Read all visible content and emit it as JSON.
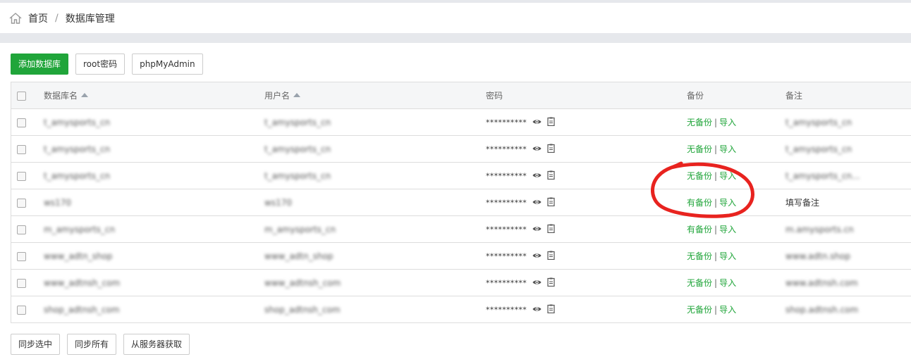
{
  "breadcrumb": {
    "home": "首页",
    "separator": "/",
    "current": "数据库管理"
  },
  "toolbar": {
    "add_db": "添加数据库",
    "root_pw": "root密码",
    "phpmyadmin": "phpMyAdmin"
  },
  "table": {
    "headers": {
      "name": "数据库名",
      "user": "用户名",
      "password": "密码",
      "backup": "备份",
      "note": "备注"
    },
    "rows": [
      {
        "name": "t_amysports_cn",
        "user": "t_amysports_cn",
        "password": "**********",
        "backup": "无备份",
        "import": "导入",
        "note": "t_amysports_cn"
      },
      {
        "name": "t_amysports_cn",
        "user": "t_amysports_cn",
        "password": "**********",
        "backup": "无备份",
        "import": "导入",
        "note": "t_amysports_cn"
      },
      {
        "name": "t_amysports_cn",
        "user": "t_amysports_cn",
        "password": "**********",
        "backup": "无备份",
        "import": "导入",
        "note": "t_amysports_cn..."
      },
      {
        "name": "ws170",
        "user": "ws170",
        "password": "**********",
        "backup": "有备份",
        "import": "导入",
        "note": "填写备注"
      },
      {
        "name": "m_amysports_cn",
        "user": "m_amysports_cn",
        "password": "**********",
        "backup": "有备份",
        "import": "导入",
        "note": "m.amysports.cn"
      },
      {
        "name": "www_adtn_shop",
        "user": "www_adtn_shop",
        "password": "**********",
        "backup": "无备份",
        "import": "导入",
        "note": "www.adtn.shop"
      },
      {
        "name": "www_adtnsh_com",
        "user": "www_adtnsh_com",
        "password": "**********",
        "backup": "无备份",
        "import": "导入",
        "note": "www.adtnsh.com"
      },
      {
        "name": "shop_adtnsh_com",
        "user": "shop_adtnsh_com",
        "password": "**********",
        "backup": "无备份",
        "import": "导入",
        "note": "shop.adtnsh.com"
      }
    ]
  },
  "bottom": {
    "sync_selected": "同步选中",
    "sync_all": "同步所有",
    "fetch_server": "从服务器获取"
  },
  "colors": {
    "accent": "#20a53a",
    "annotation": "#e8231f"
  }
}
